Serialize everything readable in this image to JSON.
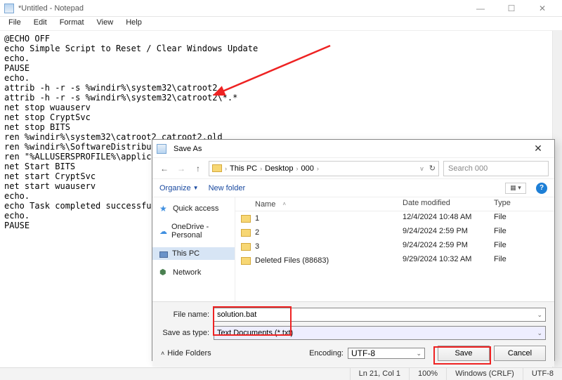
{
  "notepad": {
    "title": "*Untitled - Notepad",
    "menu": [
      "File",
      "Edit",
      "Format",
      "View",
      "Help"
    ],
    "body": "@ECHO OFF\necho Simple Script to Reset / Clear Windows Update\necho.\nPAUSE\necho.\nattrib -h -r -s %windir%\\system32\\catroot2\nattrib -h -r -s %windir%\\system32\\catroot2\\*.*\nnet stop wuauserv\nnet stop CryptSvc\nnet stop BITS\nren %windir%\\system32\\catroot2 catroot2.old\nren %windir%\\SoftwareDistribution sold.old\nren \"%ALLUSERSPROFILE%\\application data\\Microsoft\\Network\\downloader\" downloader.old\nnet Start BITS\nnet start CryptSvc\nnet start wuauserv\necho.\necho Task completed successfully...\necho.\nPAUSE",
    "status": {
      "pos": "Ln 21, Col 1",
      "zoom": "100%",
      "eol": "Windows (CRLF)",
      "enc": "UTF-8"
    }
  },
  "saveas": {
    "title": "Save As",
    "path": [
      "This PC",
      "Desktop",
      "000"
    ],
    "search_placeholder": "Search 000",
    "toolbar": {
      "organize": "Organize",
      "newfolder": "New folder"
    },
    "side": {
      "quick": "Quick access",
      "onedrive": "OneDrive - Personal",
      "thispc": "This PC",
      "network": "Network"
    },
    "columns": {
      "name": "Name",
      "date": "Date modified",
      "type": "Type"
    },
    "rows": [
      {
        "name": "1",
        "date": "12/4/2024 10:48 AM",
        "type": "File"
      },
      {
        "name": "2",
        "date": "9/24/2024 2:59 PM",
        "type": "File"
      },
      {
        "name": "3",
        "date": "9/24/2024 2:59 PM",
        "type": "File"
      },
      {
        "name": "Deleted Files (88683)",
        "date": "9/29/2024 10:32 AM",
        "type": "File"
      }
    ],
    "filename_label": "File name:",
    "filename": "solution.bat",
    "filetype_label": "Save as type:",
    "filetype": "Text Documents (*.txt)",
    "encoding_label": "Encoding:",
    "encoding": "UTF-8",
    "hide": "Hide Folders",
    "save": "Save",
    "cancel": "Cancel"
  }
}
